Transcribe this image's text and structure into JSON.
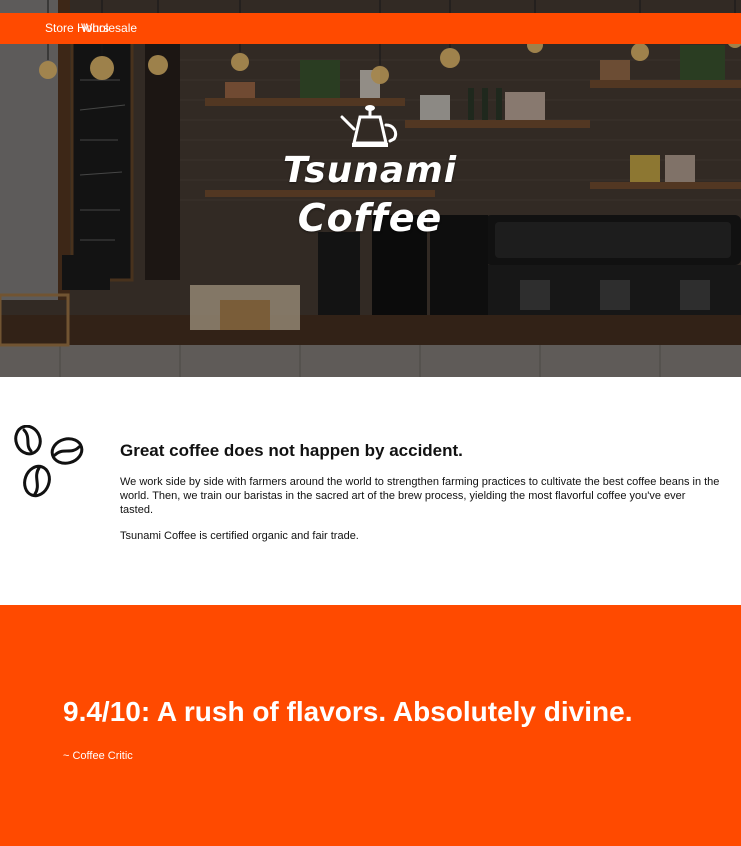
{
  "nav": {
    "links": [
      {
        "label": "Store Hours"
      },
      {
        "label": "Wholesale"
      }
    ],
    "color": "#ff4a00"
  },
  "hero": {
    "logo_line_1": "Tsunami",
    "logo_line_2": "Coffee",
    "logo_icon": "kettle-icon"
  },
  "about": {
    "icon": "coffee-beans-icon",
    "title": "Great coffee does not happen by accident.",
    "body": "We work side by side with farmers around the world to strengthen farming practices to cultivate the best coffee beans in the world. Then, we train our baristas in the sacred art of the brew process, yielding the most flavorful coffee you've ever tasted.",
    "certification": "Tsunami Coffee is certified organic and fair trade."
  },
  "review": {
    "quote": "9.4/10: A rush of flavors. Absolutely divine.",
    "author": "~ Coffee Critic",
    "color": "#ff4a00"
  }
}
